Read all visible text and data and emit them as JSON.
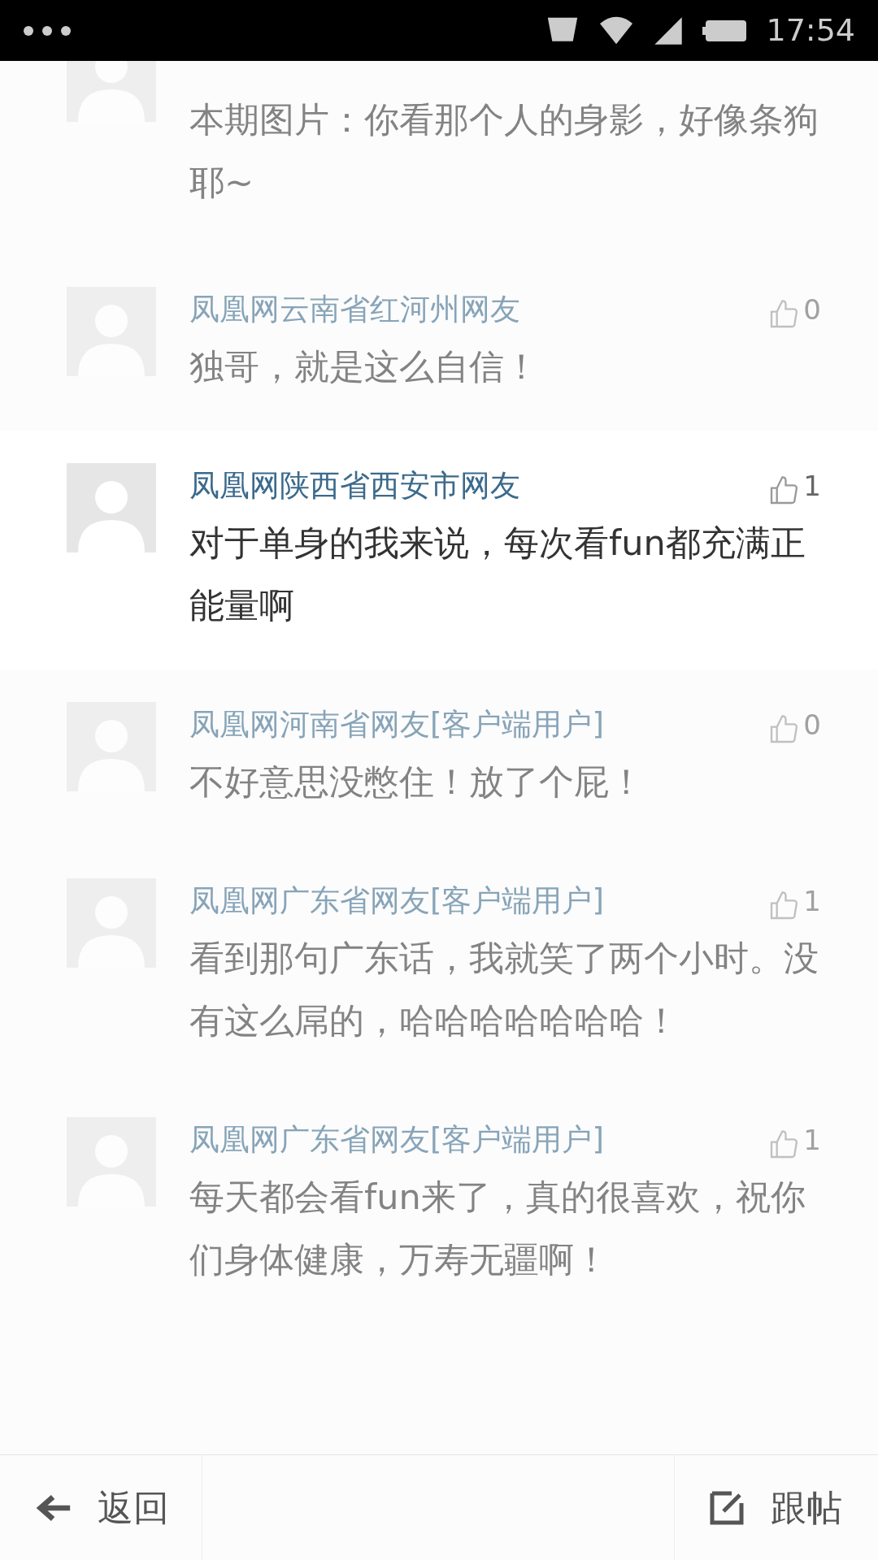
{
  "status_bar": {
    "time": "17:54"
  },
  "comments": [
    {
      "focused": false,
      "body": "本期图片：你看那个人的身影，好像条狗耶~"
    },
    {
      "focused": false,
      "user": "凤凰网云南省红河州网友",
      "likes": "0",
      "body": "独哥，就是这么自信！"
    },
    {
      "focused": true,
      "user": "凤凰网陕西省西安市网友",
      "likes": "1",
      "body": "对于单身的我来说，每次看fun都充满正能量啊"
    },
    {
      "focused": false,
      "user": "凤凰网河南省网友[客户端用户]",
      "likes": "0",
      "body": "不好意思没憋住！放了个屁！"
    },
    {
      "focused": false,
      "user": "凤凰网广东省网友[客户端用户]",
      "likes": "1",
      "body": "看到那句广东话，我就笑了两个小时。没有这么屌的，哈哈哈哈哈哈哈！"
    },
    {
      "focused": false,
      "user": "凤凰网广东省网友[客户端用户]",
      "likes": "1",
      "body": "每天都会看fun来了，真的很喜欢，祝你们身体健康，万寿无疆啊！"
    }
  ],
  "bottom_bar": {
    "back": "返回",
    "reply": "跟帖"
  }
}
